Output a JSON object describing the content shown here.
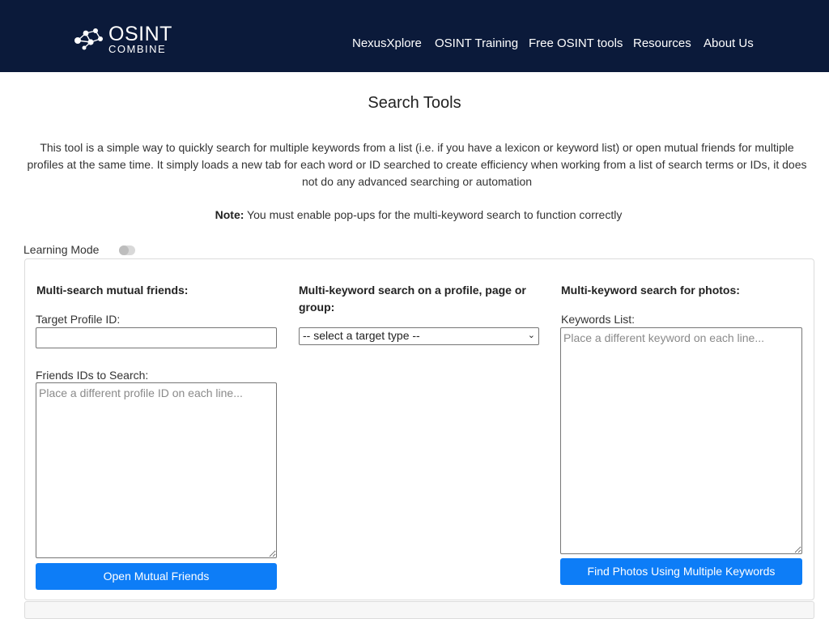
{
  "header": {
    "logo": {
      "line1": "OSINT",
      "line2": "COMBINE"
    },
    "nav": [
      "NexusXplore",
      "OSINT Training",
      "Free OSINT tools",
      "Resources",
      "About Us"
    ]
  },
  "main": {
    "title": "Search Tools",
    "intro": "This tool is a simple way to quickly search for multiple keywords from a list (i.e. if you have a lexicon or keyword list) or open mutual friends for multiple profiles at the same time. It simply loads a new tab for each word or ID searched to create efficiency when working from a list of search terms or IDs, it does not do any advanced searching or automation",
    "note_label": "Note:",
    "note_text": " You must enable pop-ups for the multi-keyword search to function correctly",
    "learning_mode_label": "Learning Mode",
    "learning_mode_on": false
  },
  "mutual": {
    "title": "Multi-search mutual friends:",
    "target_label": "Target Profile ID:",
    "target_value": "",
    "friends_label": "Friends IDs to Search:",
    "friends_placeholder": "Place a different profile ID on each line...",
    "button": "Open Mutual Friends"
  },
  "profile_search": {
    "title": "Multi-keyword search on a profile, page or group:",
    "select_value": "-- select a target type --"
  },
  "photos": {
    "title": "Multi-keyword search for photos:",
    "keywords_label": "Keywords List:",
    "keywords_placeholder": "Place a different keyword on each line...",
    "button": "Find Photos Using Multiple Keywords"
  },
  "colors": {
    "header_bg": "#0b1a3a",
    "button_bg": "#0d7df7"
  }
}
